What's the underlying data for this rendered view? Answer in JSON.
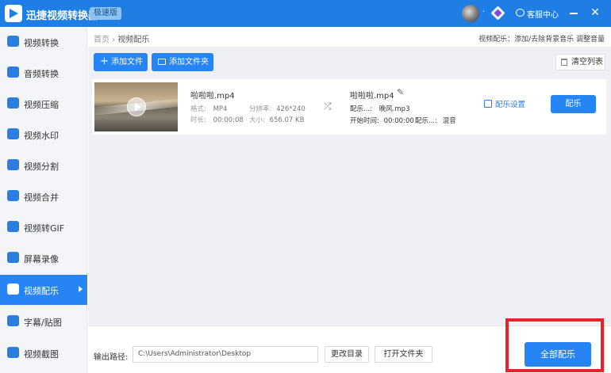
{
  "titlebar": {
    "app_name": "迅捷视频转换器",
    "edition_badge": "极速版",
    "avatar_dot": "·",
    "customer_service": "客服中心",
    "close_symbol": "✕"
  },
  "sidebar": {
    "items": [
      {
        "label": "视频转换",
        "icon": "video-convert-icon"
      },
      {
        "label": "音频转换",
        "icon": "audio-convert-icon"
      },
      {
        "label": "视频压缩",
        "icon": "video-compress-icon"
      },
      {
        "label": "视频水印",
        "icon": "watermark-icon"
      },
      {
        "label": "视频分割",
        "icon": "split-icon"
      },
      {
        "label": "视频合并",
        "icon": "merge-icon"
      },
      {
        "label": "视频转GIF",
        "icon": "gif-icon"
      },
      {
        "label": "屏幕录像",
        "icon": "screen-record-icon"
      },
      {
        "label": "视频配乐",
        "icon": "music-icon",
        "active": true
      },
      {
        "label": "字幕/贴图",
        "icon": "subtitle-icon"
      },
      {
        "label": "视频截图",
        "icon": "screenshot-icon"
      }
    ]
  },
  "breadcrumb": {
    "home": "首页",
    "separator": "›",
    "current": "视频配乐"
  },
  "feature_desc": "视频配乐：添加/去除背景音乐 调整音量",
  "toolbar": {
    "add_file": "添加文件",
    "add_folder": "添加文件夹",
    "clear_list": "清空列表",
    "plus": "+"
  },
  "file": {
    "name": "啦啦啦.mp4",
    "format_label": "格式:",
    "format_value": "MP4",
    "resolution_label": "分辨率:",
    "resolution_value": "426*240",
    "duration_label": "时长:",
    "duration_value": "00:00:08",
    "size_label": "大小:",
    "size_value": "656.07 KB",
    "output_name": "啦啦啦.mp4",
    "music_label": "配乐...:",
    "music_value": "晚风.mp3",
    "start_label": "开始时间:",
    "start_value": "00:00:00",
    "mode_label": "配乐...:",
    "mode_value": "混音",
    "settings_link": "配乐设置",
    "action_button": "配乐",
    "shuffle_symbol": "⤮",
    "edit_symbol": "✎"
  },
  "bottom": {
    "output_path_label": "输出路径:",
    "output_path_value": "C:\\Users\\Administrator\\Desktop",
    "change_dir": "更改目录",
    "open_folder": "打开文件夹",
    "process_all": "全部配乐"
  },
  "colors": {
    "accent": "#2684f4",
    "titlebar": "#1f7ee3",
    "highlight": "#e8212b"
  }
}
